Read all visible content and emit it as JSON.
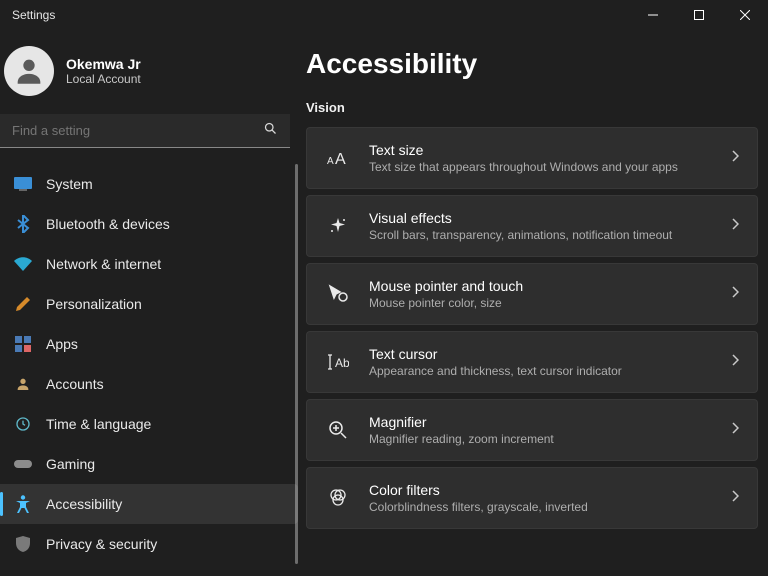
{
  "titlebar": {
    "app": "Settings"
  },
  "profile": {
    "name": "Okemwa Jr",
    "account": "Local Account"
  },
  "search": {
    "placeholder": "Find a setting"
  },
  "sidebar": {
    "items": [
      {
        "label": "System"
      },
      {
        "label": "Bluetooth & devices"
      },
      {
        "label": "Network & internet"
      },
      {
        "label": "Personalization"
      },
      {
        "label": "Apps"
      },
      {
        "label": "Accounts"
      },
      {
        "label": "Time & language"
      },
      {
        "label": "Gaming"
      },
      {
        "label": "Accessibility"
      },
      {
        "label": "Privacy & security"
      }
    ],
    "selectedIndex": 8
  },
  "content": {
    "title": "Accessibility",
    "section": "Vision",
    "cards": [
      {
        "title": "Text size",
        "sub": "Text size that appears throughout Windows and your apps"
      },
      {
        "title": "Visual effects",
        "sub": "Scroll bars, transparency, animations, notification timeout"
      },
      {
        "title": "Mouse pointer and touch",
        "sub": "Mouse pointer color, size"
      },
      {
        "title": "Text cursor",
        "sub": "Appearance and thickness, text cursor indicator"
      },
      {
        "title": "Magnifier",
        "sub": "Magnifier reading, zoom increment"
      },
      {
        "title": "Color filters",
        "sub": "Colorblindness filters, grayscale, inverted"
      }
    ]
  },
  "annotationTargetCard": 2,
  "colors": {
    "accent": "#4cc2ff",
    "arrow": "#e31818"
  }
}
